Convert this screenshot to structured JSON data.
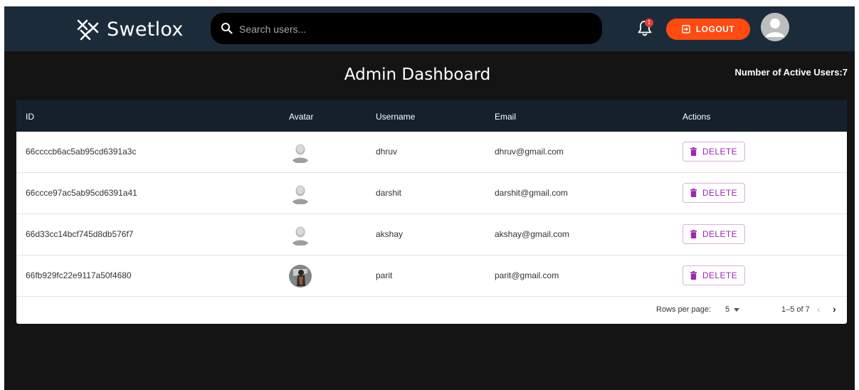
{
  "brand": {
    "name": "Swetlox"
  },
  "search": {
    "placeholder": "Search users..."
  },
  "notifications": {
    "count": "1"
  },
  "logout": {
    "label": "LOGOUT"
  },
  "page": {
    "title": "Admin Dashboard",
    "active_users_label": "Number of Active Users:",
    "active_users_count": "7"
  },
  "table": {
    "headers": [
      "ID",
      "Avatar",
      "Username",
      "Email",
      "Actions"
    ],
    "rows": [
      {
        "id": "66ccccb6ac5ab95cd6391a3c",
        "avatar": "default-avatar-icon",
        "username": "dhruv",
        "email": "dhruv@gmail.com",
        "action": "DELETE"
      },
      {
        "id": "66ccce97ac5ab95cd6391a41",
        "avatar": "default-avatar-icon",
        "username": "darshit",
        "email": "darshit@gmail.com",
        "action": "DELETE"
      },
      {
        "id": "66d33cc14bcf745d8db576f7",
        "avatar": "default-avatar-icon",
        "username": "akshay",
        "email": "akshay@gmail.com",
        "action": "DELETE"
      },
      {
        "id": "66fb929fc22e9117a50f4680",
        "avatar": "photo-avatar",
        "username": "parit",
        "email": "parit@gmail.com",
        "action": "DELETE"
      }
    ]
  },
  "pagination": {
    "rows_per_page_label": "Rows per page:",
    "rows_per_page": "5",
    "range": "1–5 of 7",
    "prev": "‹",
    "next": "›"
  },
  "colors": {
    "topbar": "#1c2b3a",
    "background": "#141414",
    "table_header": "#15202c",
    "logout": "#ff4a10",
    "delete": "#9c27b0",
    "badge": "#e53935"
  }
}
